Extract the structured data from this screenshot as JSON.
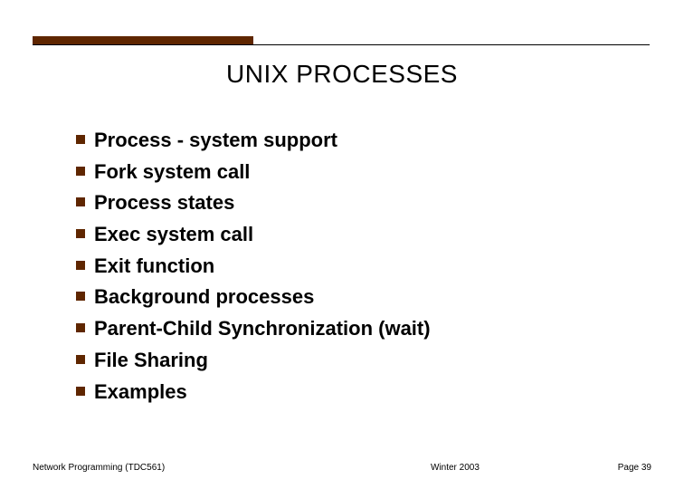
{
  "title": "UNIX PROCESSES",
  "bullets": [
    "Process - system support",
    "Fork system call",
    "Process states",
    "Exec system call",
    "Exit function",
    "Background processes",
    "Parent-Child Synchronization (wait)",
    "File Sharing",
    "Examples"
  ],
  "footer": {
    "left": "Network Programming (TDC561)",
    "center": "Winter  2003",
    "right": "Page 39"
  }
}
